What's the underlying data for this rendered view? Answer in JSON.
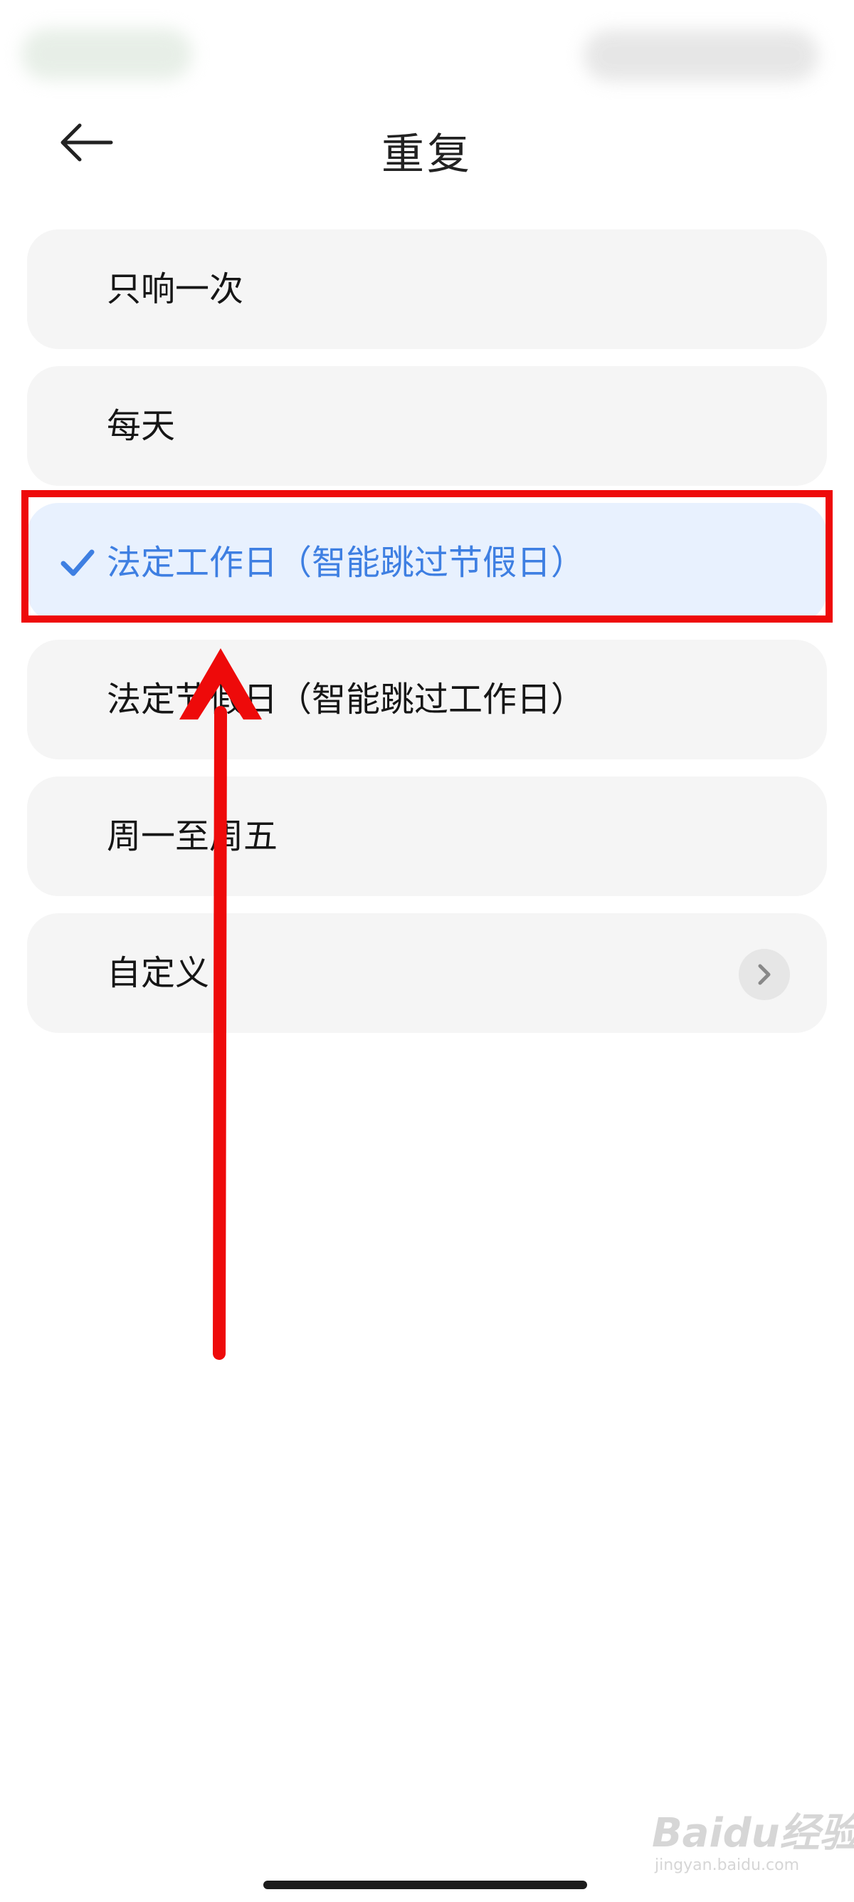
{
  "header": {
    "title": "重复",
    "back_icon": "arrow-left-icon"
  },
  "options": [
    {
      "label": "只响一次",
      "selected": false
    },
    {
      "label": "每天",
      "selected": false
    },
    {
      "label": "法定工作日（智能跳过节假日）",
      "selected": true
    },
    {
      "label": "法定节假日（智能跳过工作日）",
      "selected": false
    },
    {
      "label": "周一至周五",
      "selected": false
    },
    {
      "label": "自定义",
      "selected": false,
      "has_chevron": true
    }
  ],
  "colors": {
    "accent": "#3e7fe2",
    "selected_background": "#e8f1fe",
    "option_background": "#f5f5f5",
    "annotation_red": "#ee0a0a"
  },
  "watermark": {
    "logo": "Baidu经验",
    "url": "jingyan.baidu.com"
  }
}
